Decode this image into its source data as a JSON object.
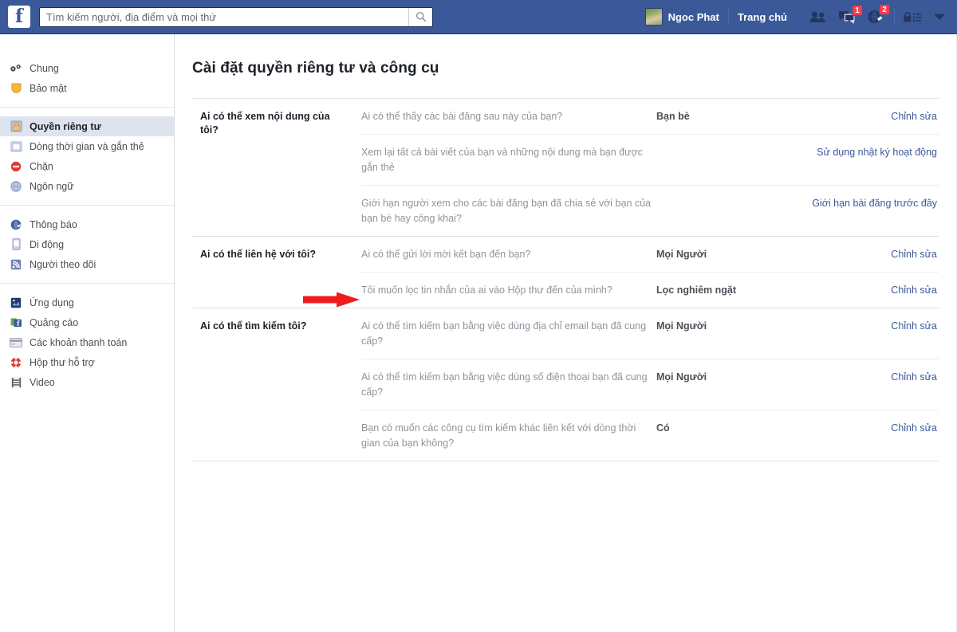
{
  "header": {
    "logo": "facebook-f-logo",
    "search": {
      "placeholder": "Tìm kiếm người, địa điểm và mọi thứ",
      "value": "",
      "icon": "search-icon"
    },
    "user_name": "Ngoc Phat",
    "home_label": "Trang chủ",
    "icons": [
      {
        "name": "friend-requests-icon",
        "badge": ""
      },
      {
        "name": "messages-icon",
        "badge": "1"
      },
      {
        "name": "notifications-globe-icon",
        "badge": "2"
      }
    ],
    "privacy_shortcuts_icon": "privacy-lock-icon",
    "account_menu_icon": "chevron-down-icon",
    "bar_color": "#3b5998",
    "badge_color": "#fa3c4c"
  },
  "sidebar": {
    "groups": [
      {
        "items": [
          {
            "label": "Chung",
            "icon": "gear-icon",
            "selected": false
          },
          {
            "label": "Bảo mật",
            "icon": "shield-icon",
            "selected": false
          }
        ]
      },
      {
        "items": [
          {
            "label": "Quyền riêng tư",
            "icon": "lock-icon",
            "selected": true
          },
          {
            "label": "Dòng thời gian và gắn thẻ",
            "icon": "timeline-icon",
            "selected": false
          },
          {
            "label": "Chặn",
            "icon": "block-icon",
            "selected": false
          },
          {
            "label": "Ngôn ngữ",
            "icon": "globe-icon",
            "selected": false
          }
        ]
      },
      {
        "items": [
          {
            "label": "Thông báo",
            "icon": "notification-globe-icon",
            "selected": false
          },
          {
            "label": "Di động",
            "icon": "mobile-icon",
            "selected": false
          },
          {
            "label": "Người theo dõi",
            "icon": "rss-follower-icon",
            "selected": false
          }
        ]
      },
      {
        "items": [
          {
            "label": "Ứng dụng",
            "icon": "apps-icon",
            "selected": false
          },
          {
            "label": "Quảng cáo",
            "icon": "ads-icon",
            "selected": false
          },
          {
            "label": "Các khoản thanh toán",
            "icon": "payments-card-icon",
            "selected": false
          },
          {
            "label": "Hộp thư hỗ trợ",
            "icon": "support-lifering-icon",
            "selected": false
          },
          {
            "label": "Video",
            "icon": "video-film-icon",
            "selected": false
          }
        ]
      }
    ],
    "selected_bg": "#dfe3ee"
  },
  "main": {
    "title": "Cài đặt quyền riêng tư và công cụ",
    "sections": [
      {
        "title": "Ai có thể xem nội dung của tôi?",
        "rows": [
          {
            "question": "Ai có thể thấy các bài đăng sau này của bạn?",
            "value": "Bạn bè",
            "action": "Chỉnh sửa"
          },
          {
            "question": "Xem lại tất cả bài viết của bạn và những nội dung mà bạn được gắn thẻ",
            "value": "",
            "action": "Sử dụng nhật ký hoạt động"
          },
          {
            "question": "Giới hạn người xem cho các bài đăng bạn đã chia sẻ với bạn của bạn bè hay công khai?",
            "value": "",
            "action": "Giới hạn bài đăng trước đây"
          }
        ]
      },
      {
        "title": "Ai có thể liên hệ với tôi?",
        "rows": [
          {
            "question": "Ai có thể gửi lời mời kết bạn đến bạn?",
            "value": "Mọi Người",
            "action": "Chỉnh sửa"
          },
          {
            "question": "Tôi muốn lọc tin nhắn của ai vào Hộp thư đến của mình?",
            "value": "Lọc nghiêm ngặt",
            "action": "Chỉnh sửa"
          }
        ]
      },
      {
        "title": "Ai có thể tìm kiếm tôi?",
        "rows": [
          {
            "question": "Ai có thể tìm kiếm bạn bằng việc dùng địa chỉ email bạn đã cung cấp?",
            "value": "Mọi Người",
            "action": "Chỉnh sửa"
          },
          {
            "question": "Ai có thể tìm kiếm bạn bằng việc dùng số điện thoại bạn đã cung cấp?",
            "value": "Mọi Người",
            "action": "Chỉnh sửa"
          },
          {
            "question": "Bạn có muốn các công cụ tìm kiếm khác liên kết với dòng thời gian của bạn không?",
            "value": "Có",
            "action": "Chỉnh sửa"
          }
        ]
      }
    ]
  },
  "annotation": {
    "arrow": "red-arrow-pointing-right",
    "color": "#ee1c1c"
  }
}
